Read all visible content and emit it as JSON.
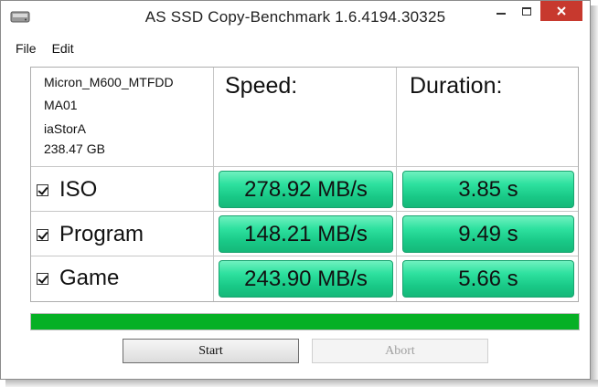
{
  "window": {
    "title": "AS SSD Copy-Benchmark 1.6.4194.30325"
  },
  "menu": [
    "File",
    "Edit"
  ],
  "drive_info": {
    "model_line1": "Micron_M600_MTFDD",
    "model_line2": "MA01",
    "driver": "iaStorA",
    "capacity": "238.47 GB"
  },
  "columns": {
    "speed_header": "Speed:",
    "duration_header": "Duration:"
  },
  "rows": [
    {
      "name": "ISO",
      "checked": true,
      "speed": "278.92 MB/s",
      "duration": "3.85 s"
    },
    {
      "name": "Program",
      "checked": true,
      "speed": "148.21 MB/s",
      "duration": "9.49 s"
    },
    {
      "name": "Game",
      "checked": true,
      "speed": "243.90 MB/s",
      "duration": "5.66 s"
    }
  ],
  "progress": {
    "fraction": 1.0,
    "color": "#06b025"
  },
  "buttons": {
    "start": "Start",
    "abort": "Abort"
  },
  "colors": {
    "result_cell": "#2ee19f",
    "close_button": "#c7392e"
  }
}
